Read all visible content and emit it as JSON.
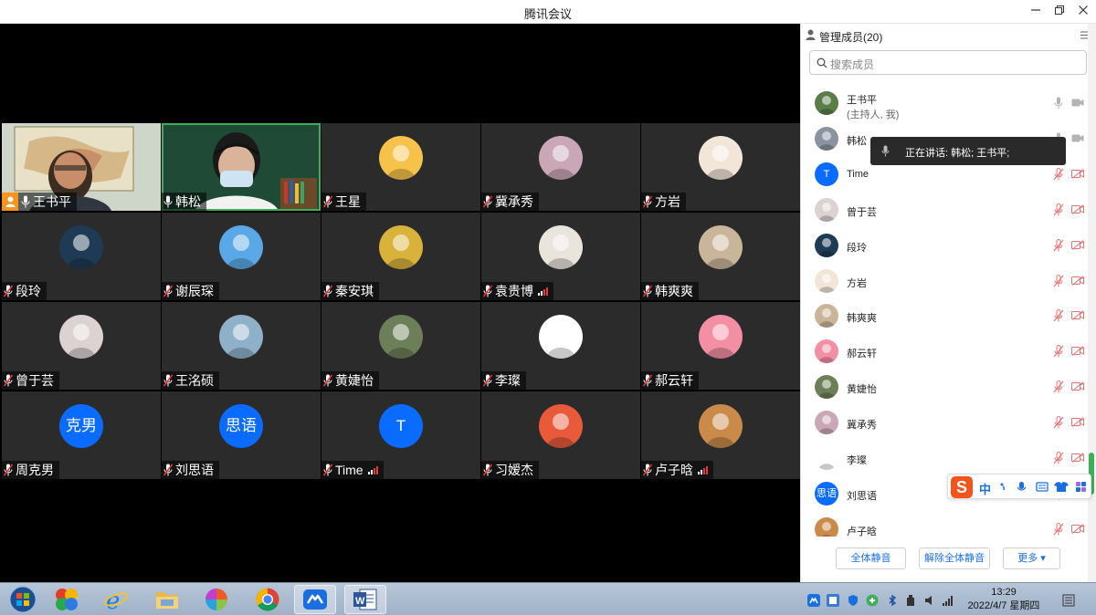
{
  "window": {
    "title": "腾讯会议",
    "minimize_icon": "minimize-icon",
    "restore_icon": "restore-icon",
    "close_icon": "close-icon"
  },
  "tiles": [
    {
      "name": "王书平",
      "type": "video",
      "host": true,
      "mic": "on"
    },
    {
      "name": "韩松",
      "type": "video",
      "speaking": true,
      "mic": "on"
    },
    {
      "name": "王星",
      "type": "avatar",
      "color": "#f6c24a",
      "mic": "muted"
    },
    {
      "name": "冀承秀",
      "type": "avatar",
      "color": "#c9a7b6",
      "mic": "muted"
    },
    {
      "name": "方岩",
      "type": "avatar",
      "color": "#f2e6d8",
      "mic": "muted"
    },
    {
      "name": "段玲",
      "type": "avatar",
      "color": "#1f3a55",
      "mic": "muted"
    },
    {
      "name": "谢辰琛",
      "type": "avatar",
      "color": "#5aa9e6",
      "mic": "muted"
    },
    {
      "name": "秦安琪",
      "type": "avatar",
      "color": "#d8b23a",
      "mic": "muted"
    },
    {
      "name": "袁贵博",
      "type": "avatar",
      "color": "#e9e4dc",
      "mic": "muted",
      "signal": true
    },
    {
      "name": "韩爽爽",
      "type": "avatar",
      "color": "#c9b59a",
      "mic": "muted"
    },
    {
      "name": "曾于芸",
      "type": "avatar",
      "color": "#ddd2d2",
      "mic": "muted"
    },
    {
      "name": "王洺硕",
      "type": "avatar",
      "color": "#8fb0c9",
      "mic": "muted"
    },
    {
      "name": "黄婕怡",
      "type": "avatar",
      "color": "#6d7f58",
      "mic": "muted"
    },
    {
      "name": "李璨",
      "type": "avatar",
      "color": "#ffffff",
      "mic": "muted"
    },
    {
      "name": "郝云轩",
      "type": "avatar",
      "color": "#f28fa4",
      "mic": "muted"
    },
    {
      "name": "周克男",
      "type": "text",
      "initials": "克男",
      "mic": "muted"
    },
    {
      "name": "刘思语",
      "type": "text",
      "initials": "思语",
      "mic": "muted"
    },
    {
      "name": "Time",
      "type": "text",
      "initials": "T",
      "mic": "muted",
      "signal": true
    },
    {
      "name": "习嫒杰",
      "type": "avatar",
      "color": "#e85a3a",
      "mic": "muted"
    },
    {
      "name": "卢子晗",
      "type": "avatar",
      "color": "#c98a4a",
      "mic": "muted",
      "signal": true
    }
  ],
  "panel": {
    "title": "管理成员(20)",
    "search_placeholder": "搜索成员",
    "members": [
      {
        "name": "王书平",
        "sub": "(主持人, 我)",
        "color": "#5b7d4a",
        "mic": "on",
        "cam": "on"
      },
      {
        "name": "韩松",
        "sub": "",
        "color": "#8b93a1",
        "mic": "on",
        "cam": "on"
      },
      {
        "name": "Time",
        "sub": "",
        "initials": "T",
        "mic": "muted",
        "cam": "off"
      },
      {
        "name": "曾于芸",
        "sub": "",
        "color": "#ddd2d2",
        "mic": "muted",
        "cam": "off"
      },
      {
        "name": "段玲",
        "sub": "",
        "color": "#1f3a55",
        "mic": "muted",
        "cam": "off"
      },
      {
        "name": "方岩",
        "sub": "",
        "color": "#f2e6d8",
        "mic": "muted",
        "cam": "off"
      },
      {
        "name": "韩爽爽",
        "sub": "",
        "color": "#c9b59a",
        "mic": "muted",
        "cam": "off"
      },
      {
        "name": "郝云轩",
        "sub": "",
        "color": "#f28fa4",
        "mic": "muted",
        "cam": "off"
      },
      {
        "name": "黄婕怡",
        "sub": "",
        "color": "#6d7f58",
        "mic": "muted",
        "cam": "off"
      },
      {
        "name": "冀承秀",
        "sub": "",
        "color": "#c9a7b6",
        "mic": "muted",
        "cam": "off"
      },
      {
        "name": "李璨",
        "sub": "",
        "color": "#ffffff",
        "mic": "muted",
        "cam": "off"
      },
      {
        "name": "刘思语",
        "sub": "",
        "initials": "思语",
        "mic": "muted",
        "cam": "off"
      },
      {
        "name": "卢子晗",
        "sub": "",
        "color": "#c98a4a",
        "mic": "muted",
        "cam": "off"
      }
    ],
    "speaking_tip": "正在讲话: 韩松; 王书平;",
    "footer": {
      "mute_all": "全体静音",
      "unmute_all": "解除全体静音",
      "more": "更多 ▾"
    }
  },
  "ime": {
    "lang": "中"
  },
  "taskbar": {
    "time": "13:29",
    "date": "2022/4/7 星期四",
    "apps": [
      "start-orb",
      "app-1",
      "ie-browser",
      "file-explorer",
      "app-pinwheel",
      "chrome-browser",
      "tencent-meeting",
      "word"
    ]
  }
}
